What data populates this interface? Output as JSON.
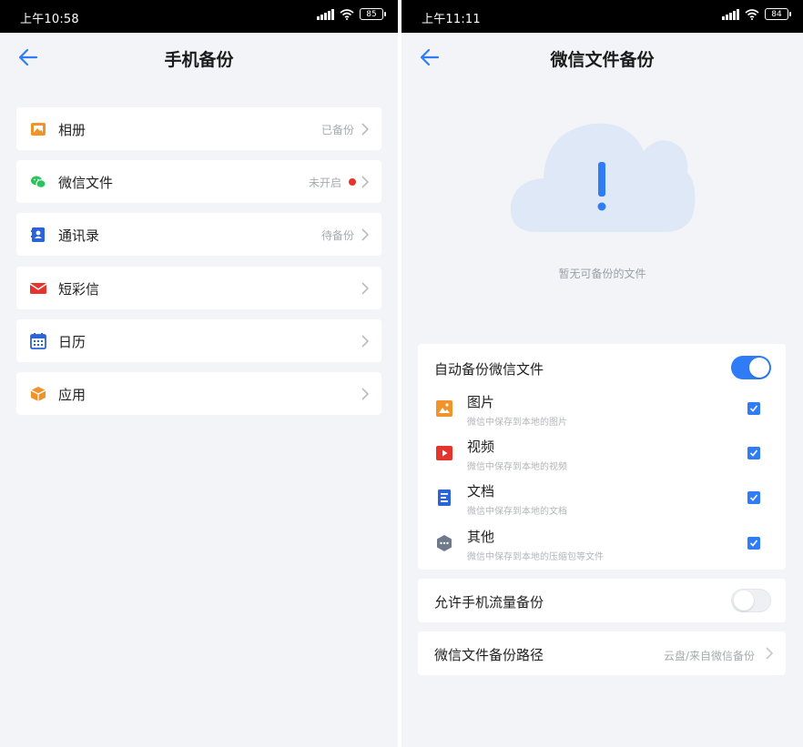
{
  "left": {
    "status": {
      "time": "上午10:58",
      "battery": "85"
    },
    "title": "手机备份",
    "items": [
      {
        "label": "相册",
        "status": "已备份",
        "icon": "photo-album-icon",
        "color": "#f0932b"
      },
      {
        "label": "微信文件",
        "status": "未开启",
        "icon": "wechat-icon",
        "color": "#2bc35a"
      },
      {
        "label": "通讯录",
        "status": "待备份",
        "icon": "contacts-icon",
        "color": "#2a64d8"
      },
      {
        "label": "短彩信",
        "status": "",
        "icon": "message-icon",
        "color": "#e5342c"
      },
      {
        "label": "日历",
        "status": "",
        "icon": "calendar-icon",
        "color": "#2a64d8"
      },
      {
        "label": "应用",
        "status": "",
        "icon": "app-box-icon",
        "color": "#f0932b"
      }
    ]
  },
  "right": {
    "status": {
      "time": "上午11:11",
      "battery": "84"
    },
    "title": "微信文件备份",
    "empty_text": "暂无可备份的文件",
    "auto_backup": {
      "label": "自动备份微信文件",
      "enabled": true
    },
    "types": [
      {
        "title": "图片",
        "desc": "微信中保存到本地的图片",
        "icon": "image-icon",
        "color": "#f0932b",
        "checked": true
      },
      {
        "title": "视频",
        "desc": "微信中保存到本地的视频",
        "icon": "video-icon",
        "color": "#e5342c",
        "checked": true
      },
      {
        "title": "文档",
        "desc": "微信中保存到本地的文档",
        "icon": "document-icon",
        "color": "#2a64d8",
        "checked": true
      },
      {
        "title": "其他",
        "desc": "微信中保存到本地的压缩包等文件",
        "icon": "other-files-icon",
        "color": "#6e7a8a",
        "checked": true
      }
    ],
    "mobile_data": {
      "label": "允许手机流量备份",
      "enabled": false
    },
    "path": {
      "label": "微信文件备份路径",
      "value": "云盘/来自微信备份"
    }
  },
  "colors": {
    "accent": "#2f7cf6",
    "background": "#f2f4f7",
    "red_dot": "#e5342c"
  }
}
